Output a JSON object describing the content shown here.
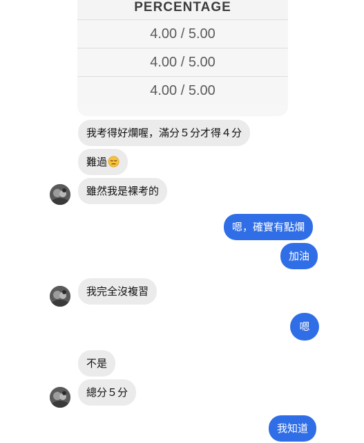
{
  "attachment": {
    "header": "PERCENTAGE",
    "rows": [
      "4.00 / 5.00",
      "4.00 / 5.00",
      "4.00 / 5.00"
    ]
  },
  "messages": {
    "m1": "我考得好爛喔，滿分５分才得４分",
    "m2": "難過",
    "m3": "雖然我是裸考的",
    "m4": "嗯，確實有點爛",
    "m5": "加油",
    "m6": "我完全沒複習",
    "m7": "嗯",
    "m8": "不是",
    "m9": "總分５分",
    "m10": "我知道"
  },
  "icons": {
    "pensive_emoji": "pensive-face-emoji",
    "avatar": "contact-avatar"
  },
  "colors": {
    "incoming_bubble": "#ebebeb",
    "outgoing_bubble": "#2f6ee6"
  }
}
